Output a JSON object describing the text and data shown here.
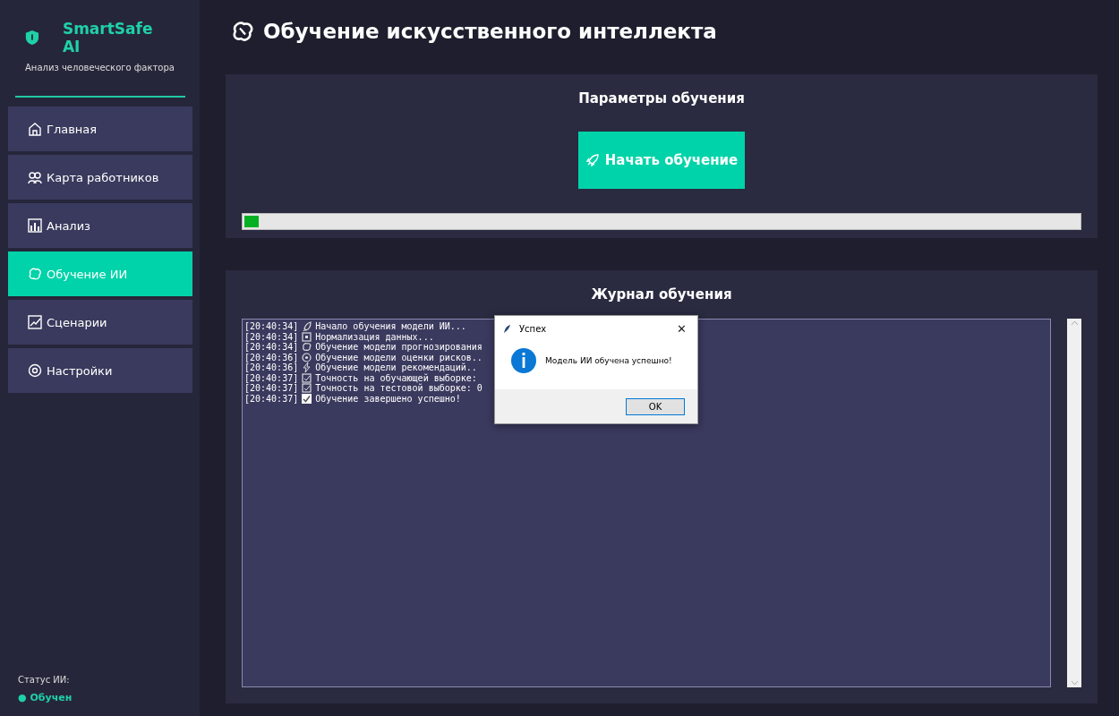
{
  "sidebar": {
    "app_name": "SmartSafe AI",
    "subtitle": "Анализ человеческого фактора",
    "items": [
      {
        "label": "Главная",
        "selected": false
      },
      {
        "label": "Карта работников",
        "selected": false
      },
      {
        "label": "Анализ",
        "selected": false
      },
      {
        "label": "Обучение ИИ",
        "selected": true
      },
      {
        "label": "Сценарии",
        "selected": false
      },
      {
        "label": "Настройки",
        "selected": false
      }
    ],
    "status_label": "Статус ИИ:",
    "status_value": "● Обучен"
  },
  "page_title": "Обучение искусственного интеллекта",
  "params_panel": {
    "title": "Параметры обучения",
    "start_button": "Начать обучение",
    "progress": {
      "level": 0.017
    }
  },
  "log_panel": {
    "title": "Журнал обучения",
    "lines": [
      {
        "time": "[20:40:34]",
        "text": "Начало обучения модели ИИ..."
      },
      {
        "time": "[20:40:34]",
        "text": "Нормализация данных..."
      },
      {
        "time": "[20:40:34]",
        "text": "Обучение модели прогнозирования"
      },
      {
        "time": "[20:40:36]",
        "text": "Обучение модели оценки рисков.."
      },
      {
        "time": "[20:40:36]",
        "text": "Обучение модели рекомендаций.."
      },
      {
        "time": "[20:40:37]",
        "text": "Точность на обучающей выборке:"
      },
      {
        "time": "[20:40:37]",
        "text": "Точность на тестовой выборке: 0"
      },
      {
        "time": "[20:40:37]",
        "text": "Обучение завершено успешно!"
      }
    ]
  },
  "dialog": {
    "title": "Успех",
    "close": "✕",
    "message": "Модель ИИ обучена успешно!",
    "ok_button": "OK"
  }
}
